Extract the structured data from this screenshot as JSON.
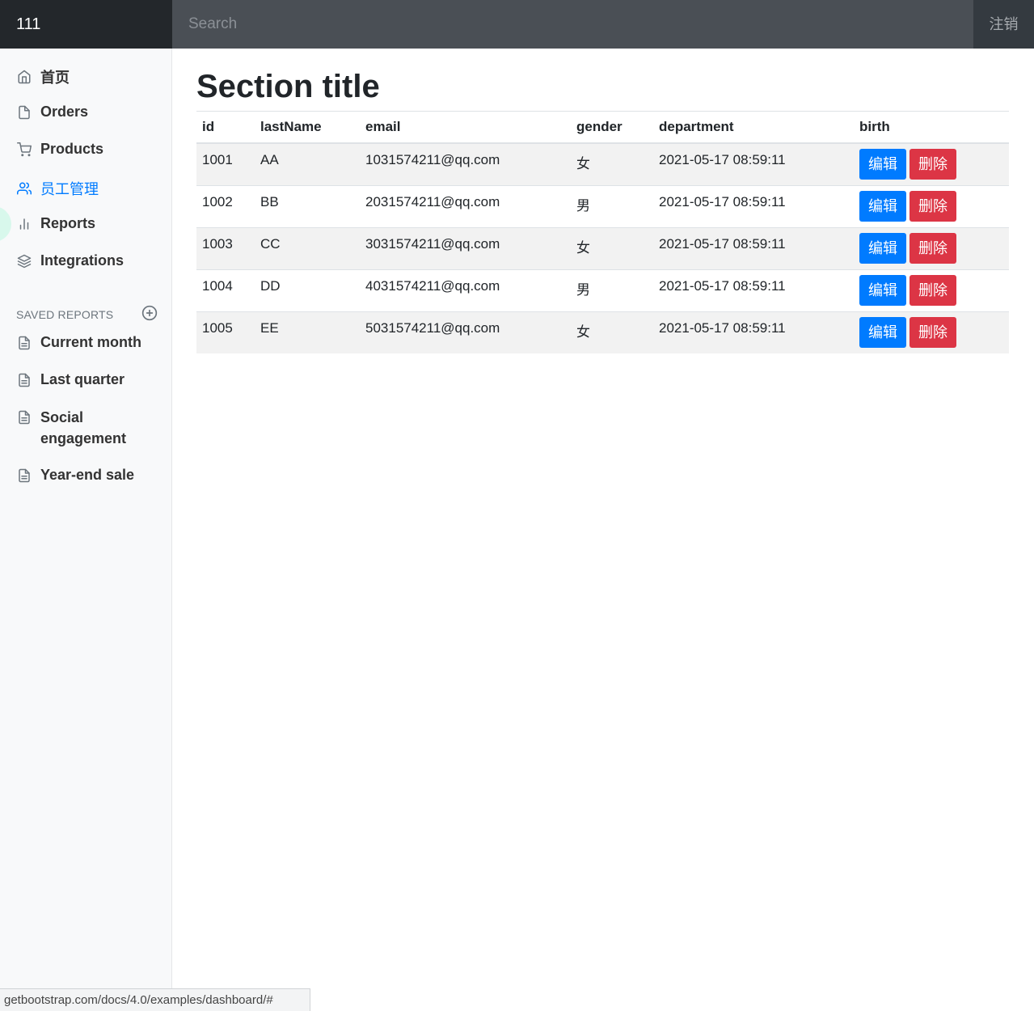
{
  "navbar": {
    "brand": "111",
    "search_placeholder": "Search",
    "logout": "注销"
  },
  "sidebar": {
    "items": [
      {
        "label": "首页",
        "icon": "home-icon"
      },
      {
        "label": "Orders",
        "icon": "file-icon"
      },
      {
        "label": "Products",
        "icon": "shopping-cart-icon"
      },
      {
        "label": "员工管理",
        "icon": "users-icon",
        "active": true
      },
      {
        "label": "Reports",
        "icon": "bar-chart-icon"
      },
      {
        "label": "Integrations",
        "icon": "layers-icon"
      }
    ],
    "saved_reports_heading": "SAVED REPORTS",
    "saved_reports": [
      {
        "label": "Current month",
        "icon": "file-text-icon"
      },
      {
        "label": "Last quarter",
        "icon": "file-text-icon"
      },
      {
        "label": "Social engagement",
        "icon": "file-text-icon"
      },
      {
        "label": "Year-end sale",
        "icon": "file-text-icon"
      }
    ]
  },
  "main": {
    "title": "Section title",
    "table": {
      "headers": [
        "id",
        "lastName",
        "email",
        "gender",
        "department",
        "birth"
      ],
      "rows": [
        {
          "id": "1001",
          "lastName": "AA",
          "email": "1031574211@qq.com",
          "gender": "女",
          "department": "2021-05-17 08:59:11"
        },
        {
          "id": "1002",
          "lastName": "BB",
          "email": "2031574211@qq.com",
          "gender": "男",
          "department": "2021-05-17 08:59:11"
        },
        {
          "id": "1003",
          "lastName": "CC",
          "email": "3031574211@qq.com",
          "gender": "女",
          "department": "2021-05-17 08:59:11"
        },
        {
          "id": "1004",
          "lastName": "DD",
          "email": "4031574211@qq.com",
          "gender": "男",
          "department": "2021-05-17 08:59:11"
        },
        {
          "id": "1005",
          "lastName": "EE",
          "email": "5031574211@qq.com",
          "gender": "女",
          "department": "2021-05-17 08:59:11"
        }
      ],
      "edit_label": "编辑",
      "delete_label": "删除"
    }
  },
  "statusbar": {
    "url": "getbootstrap.com/docs/4.0/examples/dashboard/#"
  },
  "colors": {
    "primary": "#007bff",
    "danger": "#dc3545",
    "navbar": "#343a40"
  }
}
